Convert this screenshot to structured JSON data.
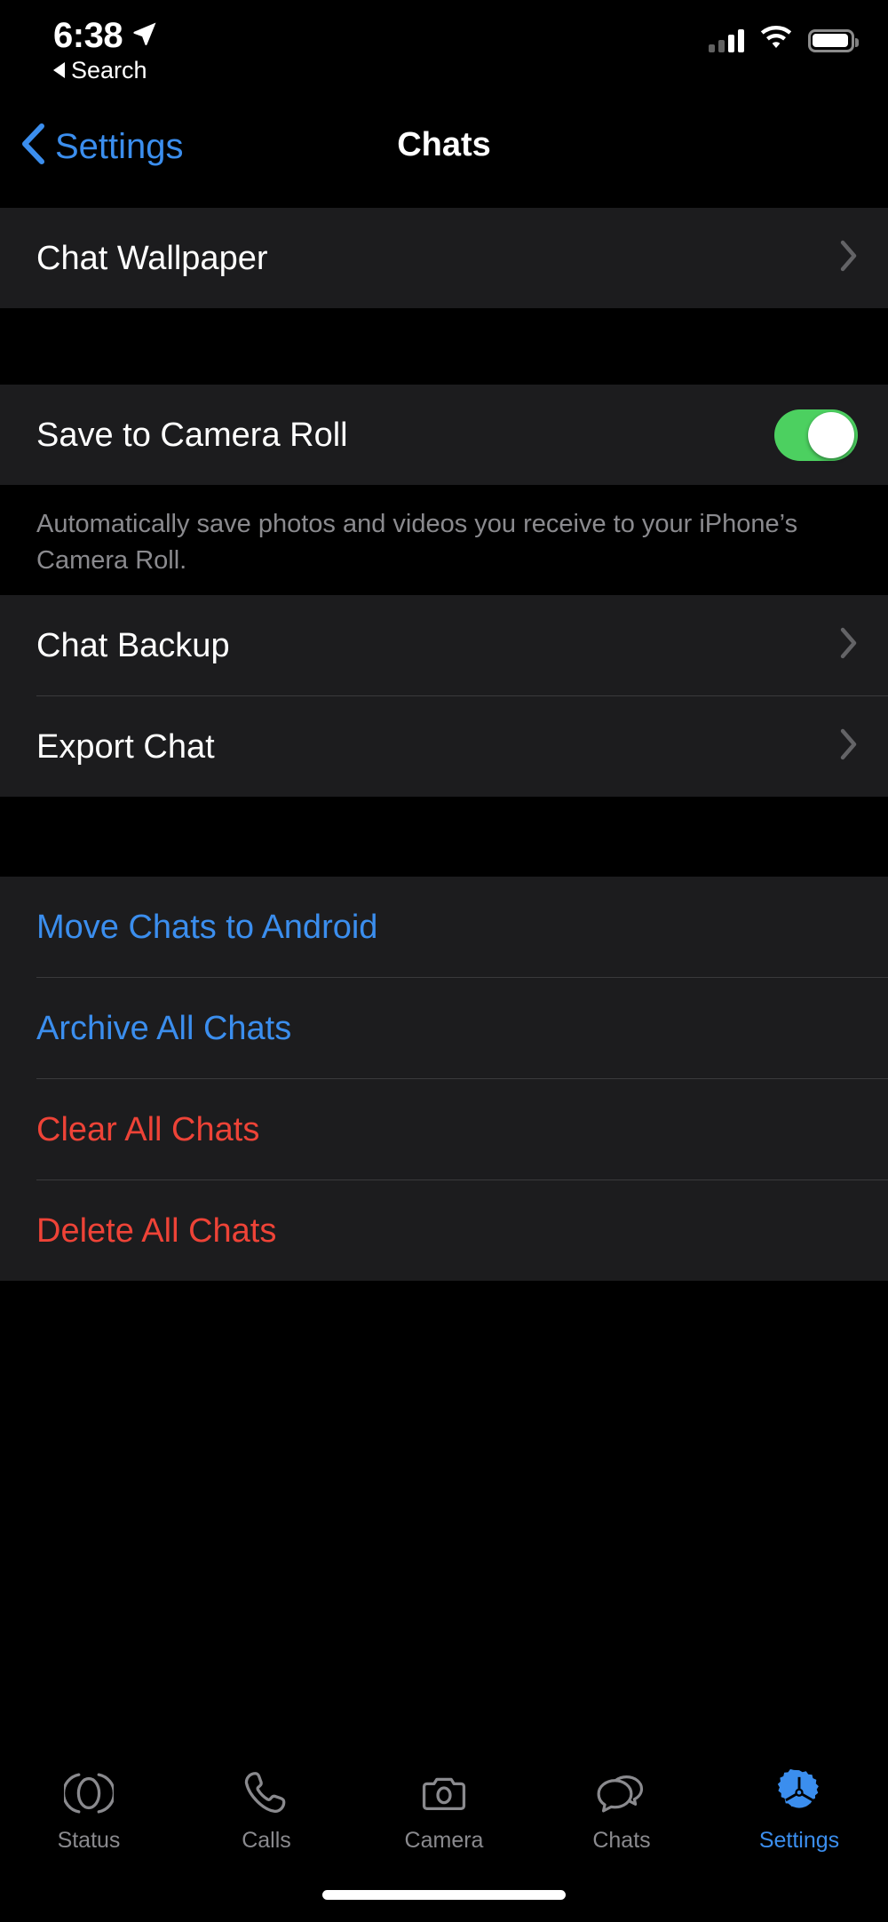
{
  "status_bar": {
    "time": "6:38",
    "location_icon": "location-arrow-icon",
    "back_to_app_label": "Search",
    "signal_icon": "cellular-signal-icon",
    "wifi_icon": "wifi-icon",
    "battery_icon": "battery-icon"
  },
  "nav_bar": {
    "back_label": "Settings",
    "back_icon": "chevron-left-icon",
    "title": "Chats"
  },
  "sections": [
    {
      "rows": [
        {
          "label": "Chat Wallpaper",
          "style": "default",
          "accessory": "chevron"
        }
      ]
    },
    {
      "rows": [
        {
          "label": "Save to Camera Roll",
          "style": "default",
          "accessory": "toggle",
          "toggle_on": true
        }
      ],
      "footer": "Automatically save photos and videos you receive to your iPhone’s Camera Roll."
    },
    {
      "rows": [
        {
          "label": "Chat Backup",
          "style": "default",
          "accessory": "chevron"
        },
        {
          "label": "Export Chat",
          "style": "default",
          "accessory": "chevron"
        }
      ]
    },
    {
      "rows": [
        {
          "label": "Move Chats to Android",
          "style": "blue",
          "accessory": "none"
        },
        {
          "label": "Archive All Chats",
          "style": "blue",
          "accessory": "none"
        },
        {
          "label": "Clear All Chats",
          "style": "red",
          "accessory": "none"
        },
        {
          "label": "Delete All Chats",
          "style": "red",
          "accessory": "none"
        }
      ]
    }
  ],
  "tab_bar": {
    "items": [
      {
        "label": "Status",
        "icon": "status-rings-icon",
        "active": false
      },
      {
        "label": "Calls",
        "icon": "phone-icon",
        "active": false
      },
      {
        "label": "Camera",
        "icon": "camera-icon",
        "active": false
      },
      {
        "label": "Chats",
        "icon": "chat-bubbles-icon",
        "active": false
      },
      {
        "label": "Settings",
        "icon": "gear-icon",
        "active": true
      }
    ]
  },
  "colors": {
    "background": "#000000",
    "row_background": "#1C1C1E",
    "separator": "#3A3A3C",
    "primary_text": "#FFFFFF",
    "secondary_text": "#8A8A8E",
    "accent_blue": "#3B8EEE",
    "destructive_red": "#EE4337",
    "toggle_on_green": "#4CD060"
  }
}
